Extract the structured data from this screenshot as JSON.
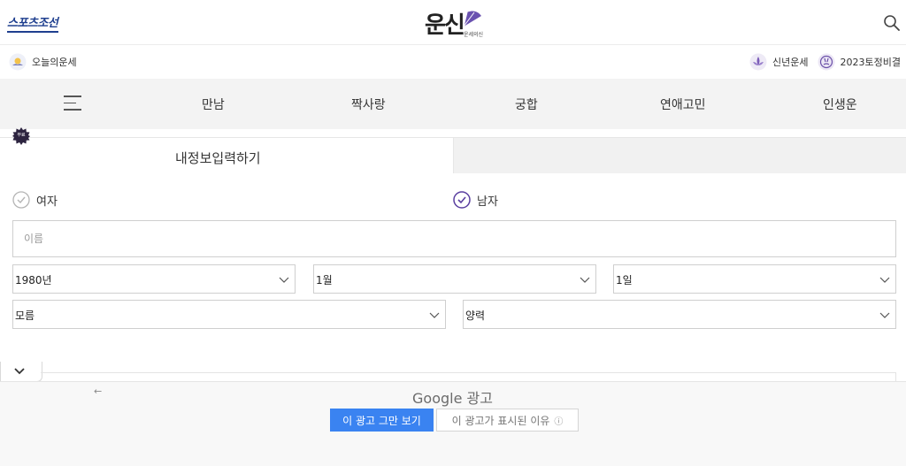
{
  "header": {
    "brand_left": "스포츠조선",
    "logo_text": "운신",
    "logo_sub": "운세의신"
  },
  "subbar": {
    "left_label": "오늘의운세",
    "right_items": [
      "신년운세",
      "2023토정비결"
    ]
  },
  "nav": {
    "items": [
      "만남",
      "짝사랑",
      "궁합",
      "연애고민",
      "인생운"
    ]
  },
  "form": {
    "badge": "무료",
    "tab_active": "내정보입력하기",
    "gender_female": "여자",
    "gender_male": "남자",
    "selected_gender": "남자",
    "name_placeholder": "이름",
    "year": "1980년",
    "month": "1월",
    "day": "1일",
    "time": "모름",
    "calendar": "양력"
  },
  "ad": {
    "back_arrow": "←",
    "google": "Google",
    "google_suffix": "광고",
    "stop_button": "이 광고 그만 보기",
    "why_button": "이 광고가 표시된 이유",
    "info_glyph": "ⓘ"
  },
  "colors": {
    "accent_purple": "#5a3fa0",
    "brand_blue": "#1f3f8f",
    "ad_blue": "#3a83f1"
  }
}
